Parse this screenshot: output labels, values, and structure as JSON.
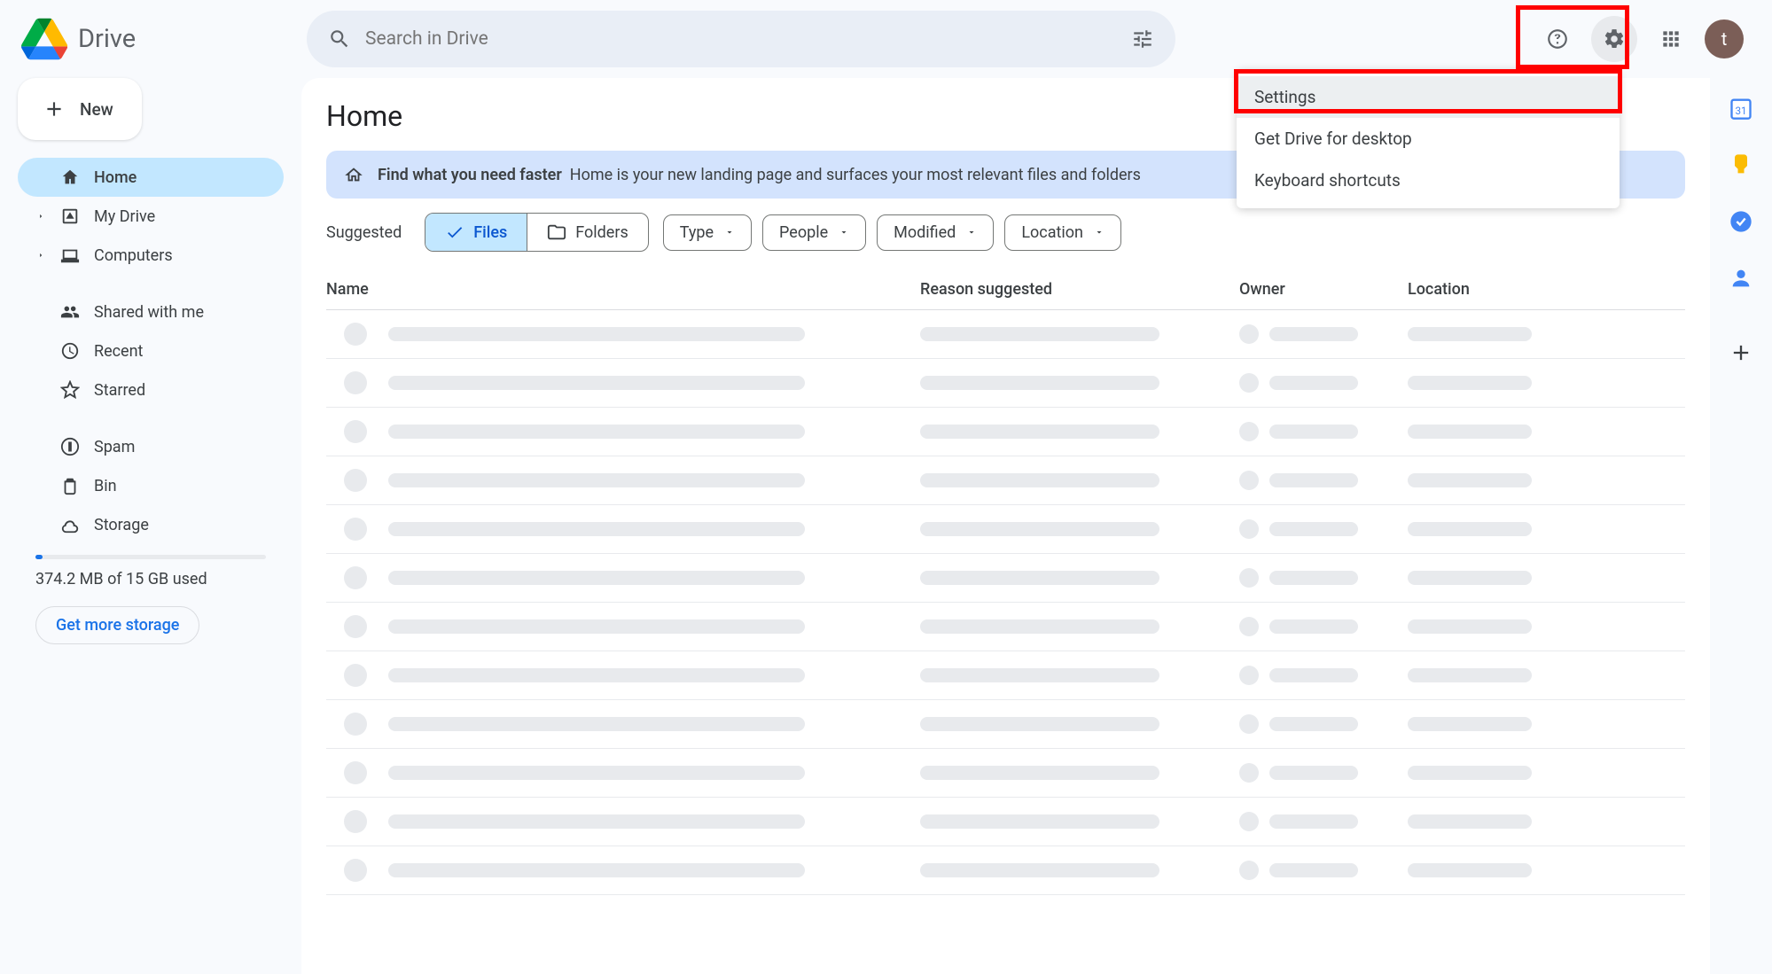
{
  "app": {
    "title": "Drive"
  },
  "search": {
    "placeholder": "Search in Drive"
  },
  "sidebar": {
    "new_label": "New",
    "items": [
      {
        "label": "Home",
        "icon": "home",
        "active": true,
        "expandable": false
      },
      {
        "label": "My Drive",
        "icon": "mydrive",
        "active": false,
        "expandable": true
      },
      {
        "label": "Computers",
        "icon": "computers",
        "active": false,
        "expandable": true
      }
    ],
    "group2": [
      {
        "label": "Shared with me",
        "icon": "shared"
      },
      {
        "label": "Recent",
        "icon": "recent"
      },
      {
        "label": "Starred",
        "icon": "star"
      }
    ],
    "group3": [
      {
        "label": "Spam",
        "icon": "spam"
      },
      {
        "label": "Bin",
        "icon": "bin"
      },
      {
        "label": "Storage",
        "icon": "storage"
      }
    ],
    "storage_used": "374.2 MB of 15 GB used",
    "storage_cta": "Get more storage"
  },
  "main": {
    "title": "Home",
    "banner": {
      "bold": "Find what you need faster",
      "text": "Home is your new landing page and surfaces your most relevant files and folders"
    },
    "suggested_label": "Suggested",
    "seg": {
      "files": "Files",
      "folders": "Folders"
    },
    "chips": [
      "Type",
      "People",
      "Modified",
      "Location"
    ],
    "columns": {
      "name": "Name",
      "reason": "Reason suggested",
      "owner": "Owner",
      "location": "Location"
    },
    "placeholder_rows": 12
  },
  "settings_menu": {
    "items": [
      "Settings",
      "Get Drive for desktop",
      "Keyboard shortcuts"
    ]
  },
  "avatar_letter": "t"
}
